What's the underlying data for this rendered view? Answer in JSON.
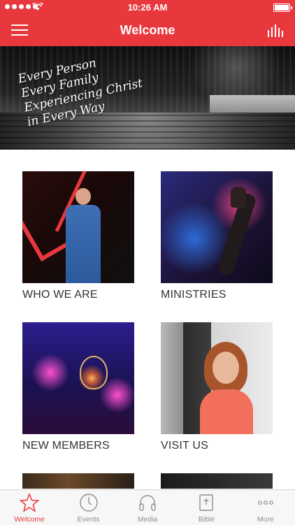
{
  "status_bar": {
    "time": "10:26 AM"
  },
  "navbar": {
    "title": "Welcome"
  },
  "hero": {
    "tagline_lines": [
      "Every Person",
      "Every Family",
      "Experiencing Christ",
      "in Every Way"
    ]
  },
  "tiles": [
    {
      "label": "WHO WE ARE"
    },
    {
      "label": "MINISTRIES"
    },
    {
      "label": "NEW MEMBERS"
    },
    {
      "label": "VISIT US"
    }
  ],
  "tabbar": {
    "items": [
      {
        "label": "Welcome",
        "icon": "star-icon",
        "active": true
      },
      {
        "label": "Events",
        "icon": "clock-icon",
        "active": false
      },
      {
        "label": "Media",
        "icon": "headphones-icon",
        "active": false
      },
      {
        "label": "Bible",
        "icon": "bible-icon",
        "active": false
      },
      {
        "label": "More",
        "icon": "more-icon",
        "active": false
      }
    ]
  },
  "colors": {
    "accent": "#e8383d",
    "tab_inactive": "#8e8e93"
  }
}
